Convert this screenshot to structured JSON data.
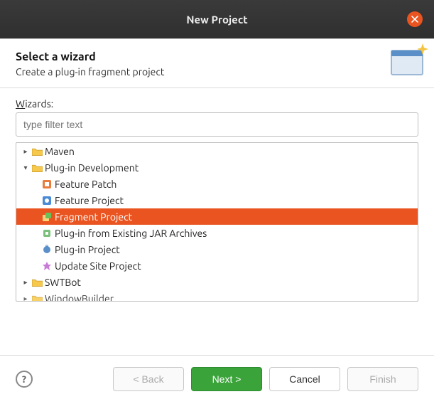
{
  "title": "New Project",
  "header": {
    "heading": "Select a wizard",
    "description": "Create a plug-in fragment project"
  },
  "wizards_label": "Wizards:",
  "filter_placeholder": "type filter text",
  "tree": {
    "maven": "Maven",
    "plugin_dev": "Plug-in Development",
    "feature_patch": "Feature Patch",
    "feature_project": "Feature Project",
    "fragment_project": "Fragment Project",
    "plugin_from_jar": "Plug-in from Existing JAR Archives",
    "plugin_project": "Plug-in Project",
    "update_site": "Update Site Project",
    "swtbot": "SWTBot",
    "windowbuilder": "WindowBuilder"
  },
  "buttons": {
    "back": "< Back",
    "next": "Next >",
    "cancel": "Cancel",
    "finish": "Finish"
  },
  "colors": {
    "accent": "#e95420",
    "primary_btn": "#3aa43a"
  }
}
